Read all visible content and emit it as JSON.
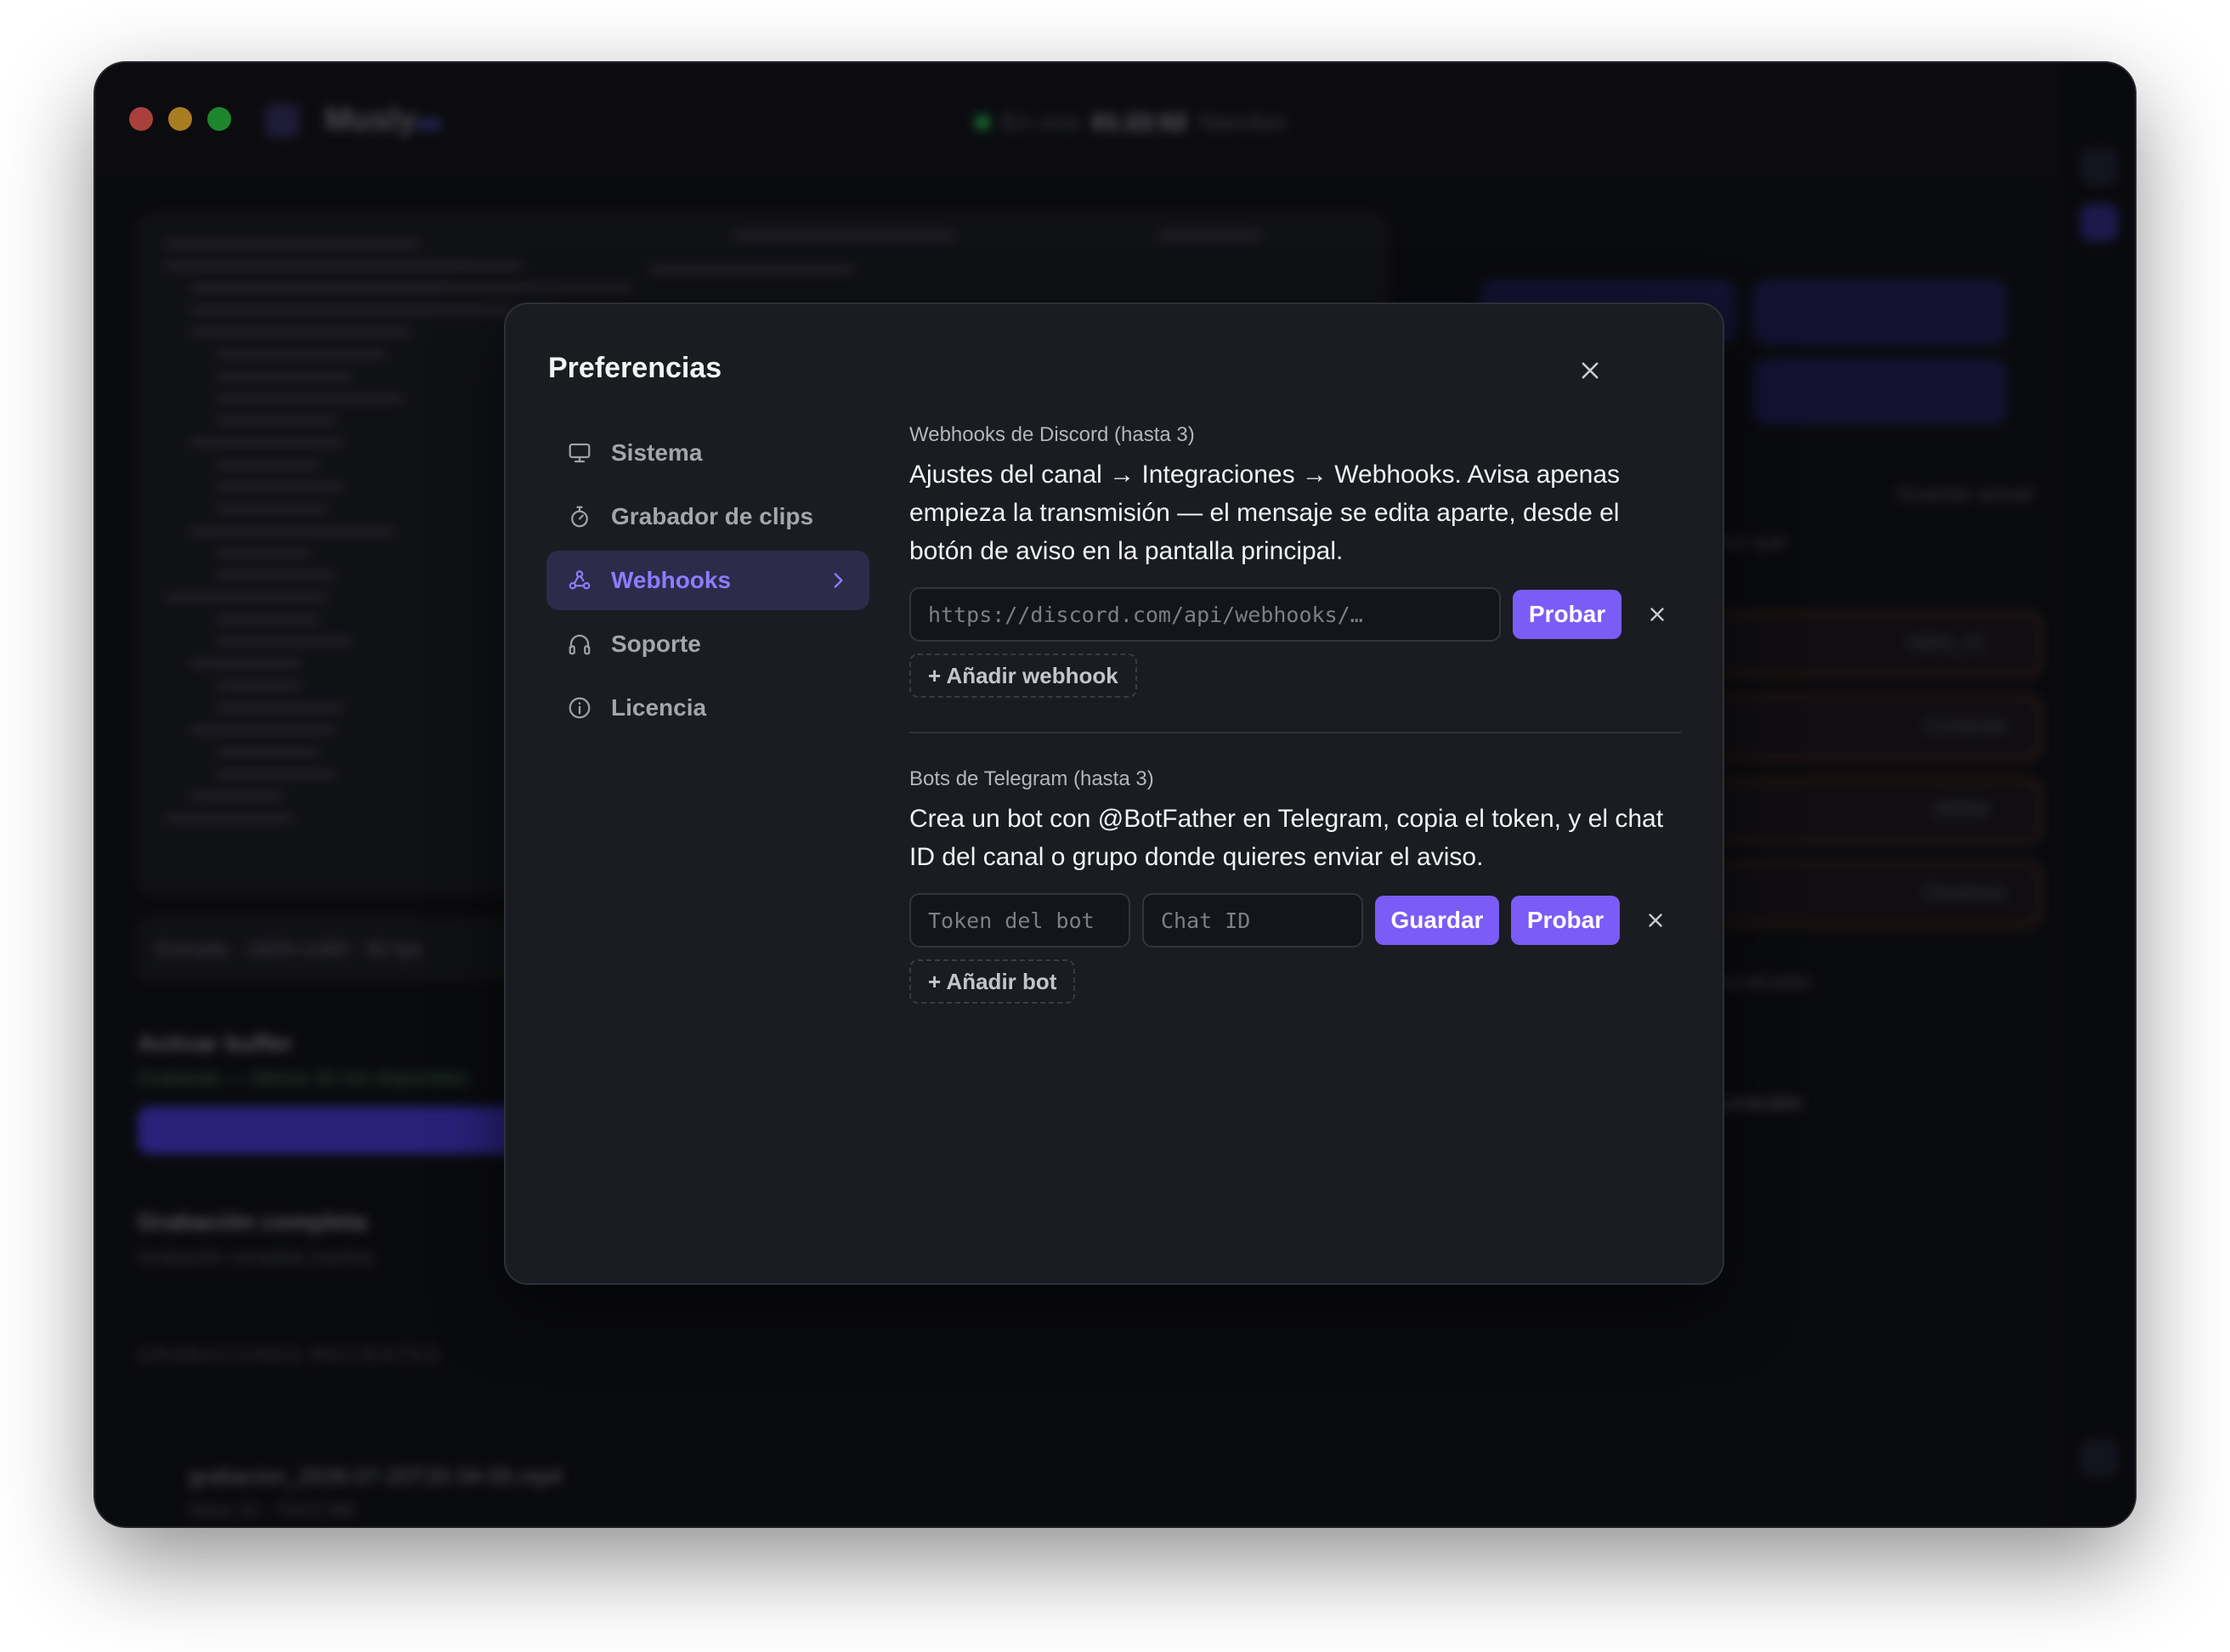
{
  "app": {
    "name": "Musly",
    "name_suffix": "on",
    "status_text": "En vivo",
    "status_time": "01:22:52",
    "status_extra": "Narcilon"
  },
  "background": {
    "info_pill": "Entrada · 1920×1080 · 60 fps",
    "buffer_label": "Activar buffer",
    "buffer_sub": "Grabando — últimos 30 min disponibles",
    "full_record_label": "Grabación completa",
    "full_record_sub": "Grabación completa inactiva",
    "recent_label": "GRABACIONES RECIENTES",
    "recent_file": "grabacion_2026-07-20T20-34-55.mp4",
    "recent_meta": "Hace 1h · 734,5 MB",
    "save_actual": "Guardar actual",
    "right_text_1": "Archiva los destinos que",
    "right_text_2": "actual",
    "right_row_1": "hdmi_v1",
    "right_row_2": "Conectar",
    "right_row_3": "4000k",
    "right_row_4": "Destinos",
    "custom": "Destino personalizado",
    "connection": "Probar conexión"
  },
  "modal": {
    "title": "Preferencias",
    "nav": [
      {
        "label": "Sistema",
        "icon": "monitor-icon"
      },
      {
        "label": "Grabador de clips",
        "icon": "stopwatch-icon"
      },
      {
        "label": "Webhooks",
        "icon": "webhook-icon",
        "active": true
      },
      {
        "label": "Soporte",
        "icon": "headphones-icon"
      },
      {
        "label": "Licencia",
        "icon": "info-icon"
      }
    ],
    "discord": {
      "label": "Webhooks de Discord (hasta 3)",
      "description": "Ajustes del canal → Integraciones → Webhooks. Avisa apenas empieza la transmisión — el mensaje se edita aparte, desde el botón de aviso en la pantalla principal.",
      "url_placeholder": "https://discord.com/api/webhooks/…",
      "test_button": "Probar",
      "add_button": "+ Añadir webhook"
    },
    "telegram": {
      "label": "Bots de Telegram (hasta 3)",
      "description": "Crea un bot con @BotFather en Telegram, copia el token, y el chat ID del canal o grupo donde quieres enviar el aviso.",
      "token_placeholder": "Token del bot",
      "chat_placeholder": "Chat ID",
      "save_button": "Guardar",
      "test_button": "Probar",
      "add_button": "+ Añadir bot"
    }
  },
  "colors": {
    "accent": "#7c5cf6",
    "active_nav_bg": "#2c2b4a",
    "active_nav_text": "#8c7dff",
    "modal_bg": "#1a1c22",
    "window_bg": "#0c0d11"
  }
}
